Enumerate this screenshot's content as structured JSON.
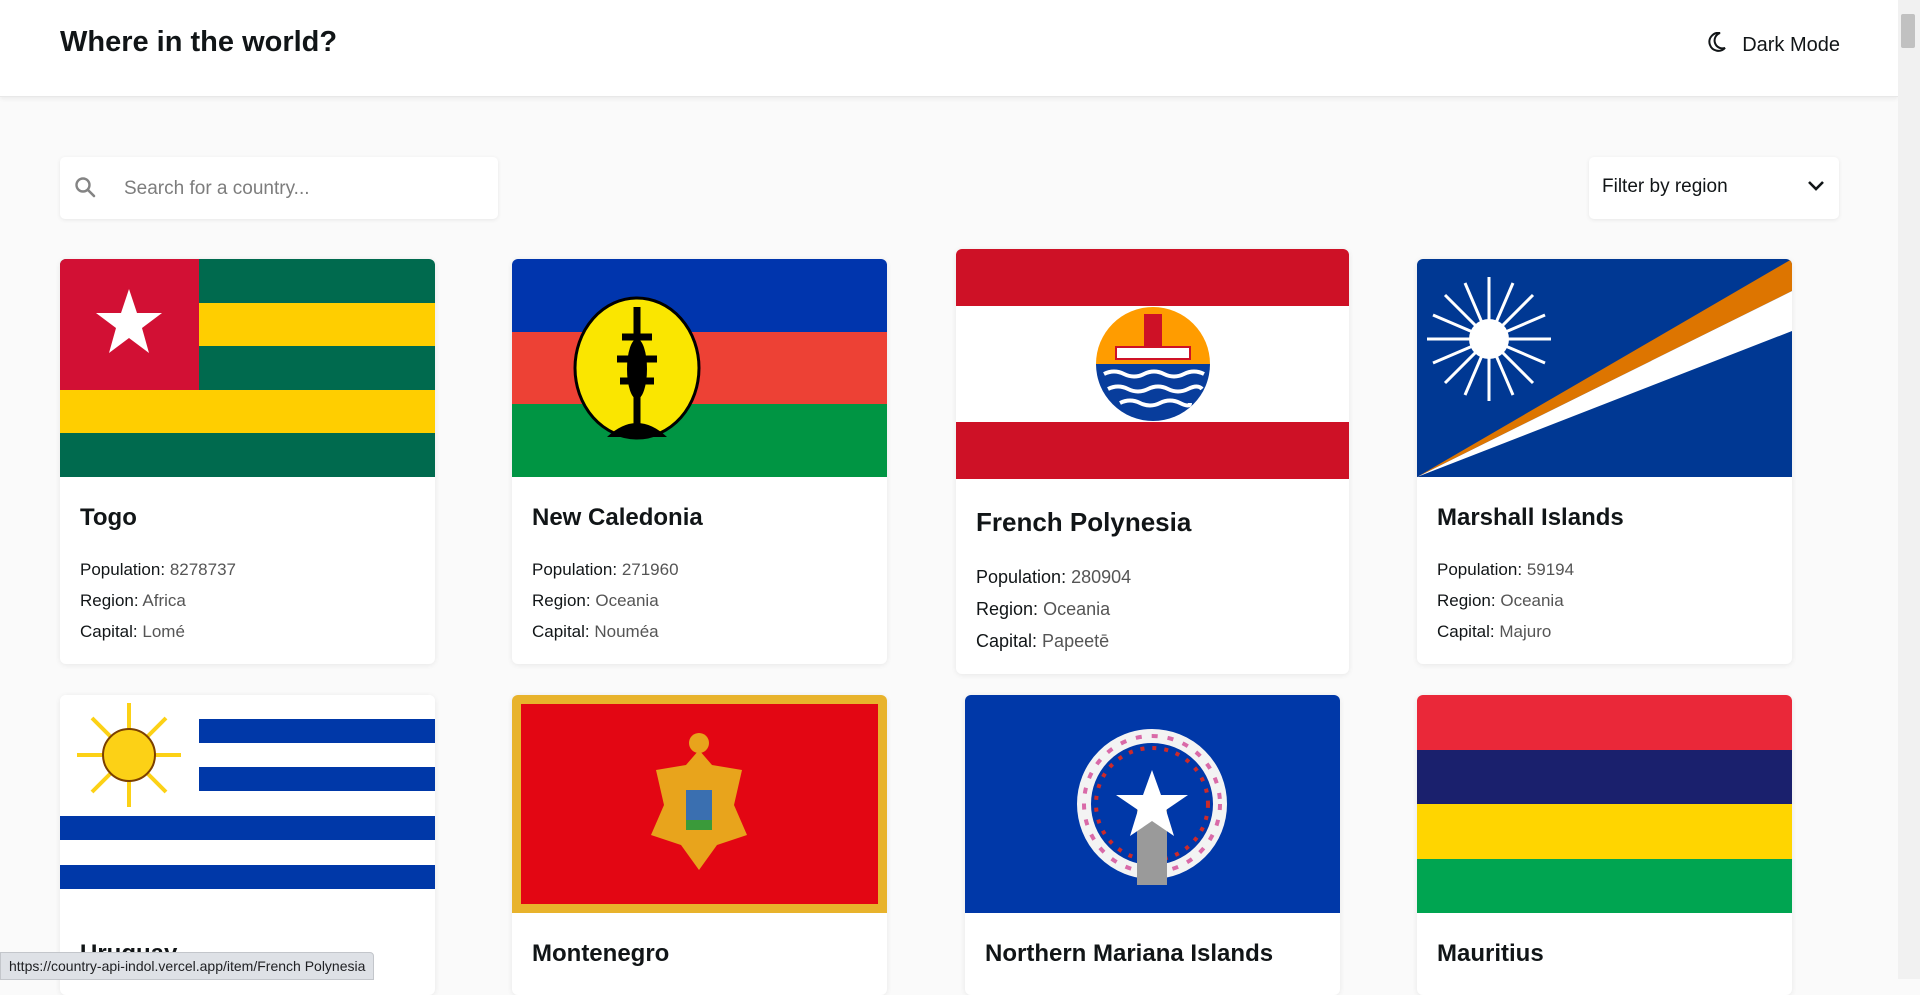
{
  "header": {
    "title": "Where in the world?",
    "mode_toggle_label": "Dark Mode",
    "mode_icon": "moon-icon"
  },
  "search": {
    "placeholder": "Search for a country...",
    "value": "",
    "icon": "search-icon"
  },
  "filter": {
    "label": "Filter by region",
    "icon": "chevron-down-icon"
  },
  "labels": {
    "population": "Population:",
    "region": "Region:",
    "capital": "Capital:"
  },
  "countries": [
    {
      "name": "Togo",
      "population": "8278737",
      "region": "Africa",
      "capital": "Lomé"
    },
    {
      "name": "New Caledonia",
      "population": "271960",
      "region": "Oceania",
      "capital": "Nouméa"
    },
    {
      "name": "French Polynesia",
      "population": "280904",
      "region": "Oceania",
      "capital": "Papeetē"
    },
    {
      "name": "Marshall Islands",
      "population": "59194",
      "region": "Oceania",
      "capital": "Majuro"
    },
    {
      "name": "Uruguay",
      "population": "",
      "region": "",
      "capital": ""
    },
    {
      "name": "Montenegro",
      "population": "",
      "region": "",
      "capital": ""
    },
    {
      "name": "Northern Mariana Islands",
      "population": "",
      "region": "",
      "capital": ""
    },
    {
      "name": "Mauritius",
      "population": "",
      "region": "",
      "capital": ""
    }
  ],
  "status_bar": {
    "url": "https://country-api-indol.vercel.app/item/French Polynesia"
  }
}
